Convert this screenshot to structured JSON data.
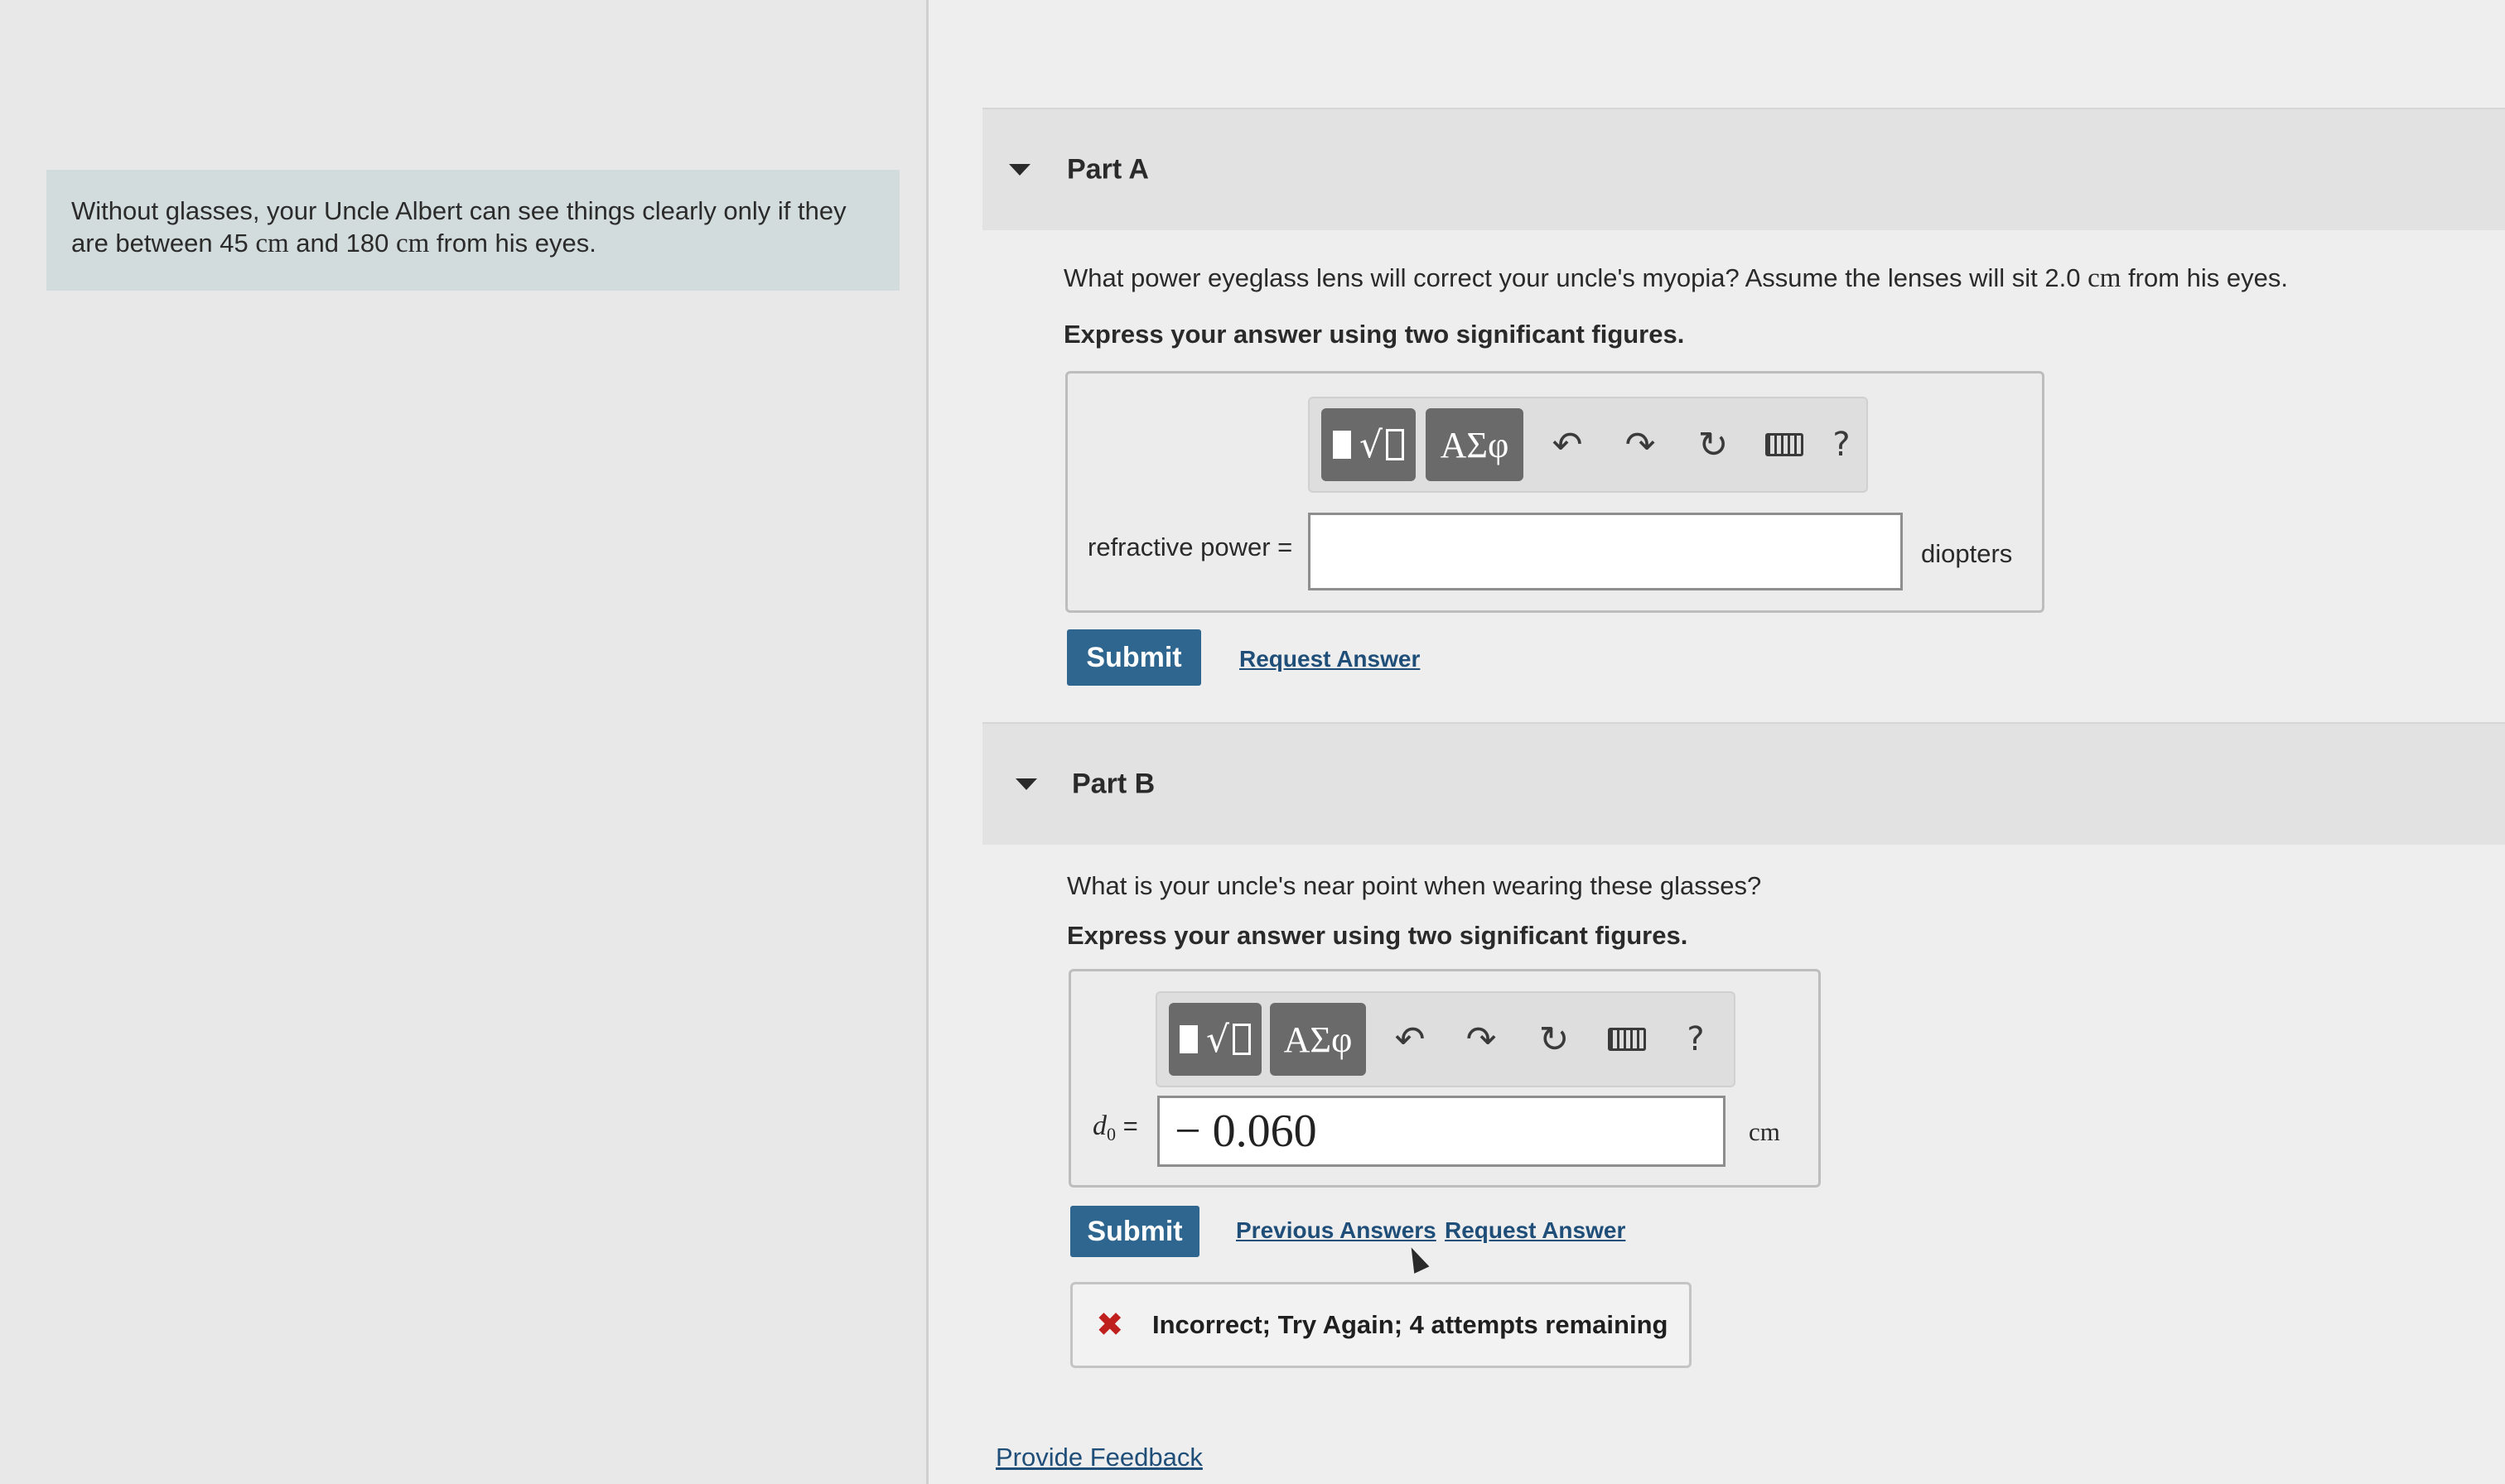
{
  "intro": {
    "line1": "Without glasses, your Uncle Albert can see things clearly only if they",
    "line2_pre": "are between 45 ",
    "unit1": "cm",
    "mid": " and 180 ",
    "unit2": "cm",
    "line2_post": " from his eyes."
  },
  "part_a": {
    "title": "Part A",
    "question_pre": "What power eyeglass lens will correct your uncle's myopia? Assume the lenses will sit 2.0 ",
    "question_unit": "cm",
    "question_post": " from his eyes.",
    "instruction": "Express your answer using two significant figures.",
    "toolbar": {
      "greek": "ΑΣφ",
      "undo": "↶",
      "redo": "↷",
      "reset": "↻",
      "help": "?"
    },
    "field_label": "refractive power =",
    "value": "",
    "unit": "diopters",
    "submit_label": "Submit",
    "request_answer_label": "Request Answer"
  },
  "part_b": {
    "title": "Part B",
    "question": "What is your uncle's near point when wearing these glasses?",
    "instruction": "Express your answer using two significant figures.",
    "toolbar": {
      "greek": "ΑΣφ",
      "undo": "↶",
      "redo": "↷",
      "reset": "↻",
      "help": "?"
    },
    "field_label_var": "d",
    "field_label_sub": "0",
    "field_label_eq": " =",
    "value": "− 0.060",
    "unit": "cm",
    "submit_label": "Submit",
    "previous_answers_label": "Previous Answers",
    "request_answer_label": "Request Answer",
    "status": "Incorrect; Try Again; 4 attempts remaining",
    "status_icon": "✖"
  },
  "feedback_label": "Provide Feedback",
  "colors": {
    "submit": "#2e6690",
    "link": "#1f4e79",
    "error": "#c0201d",
    "intro_bg": "#d3dcdc"
  }
}
